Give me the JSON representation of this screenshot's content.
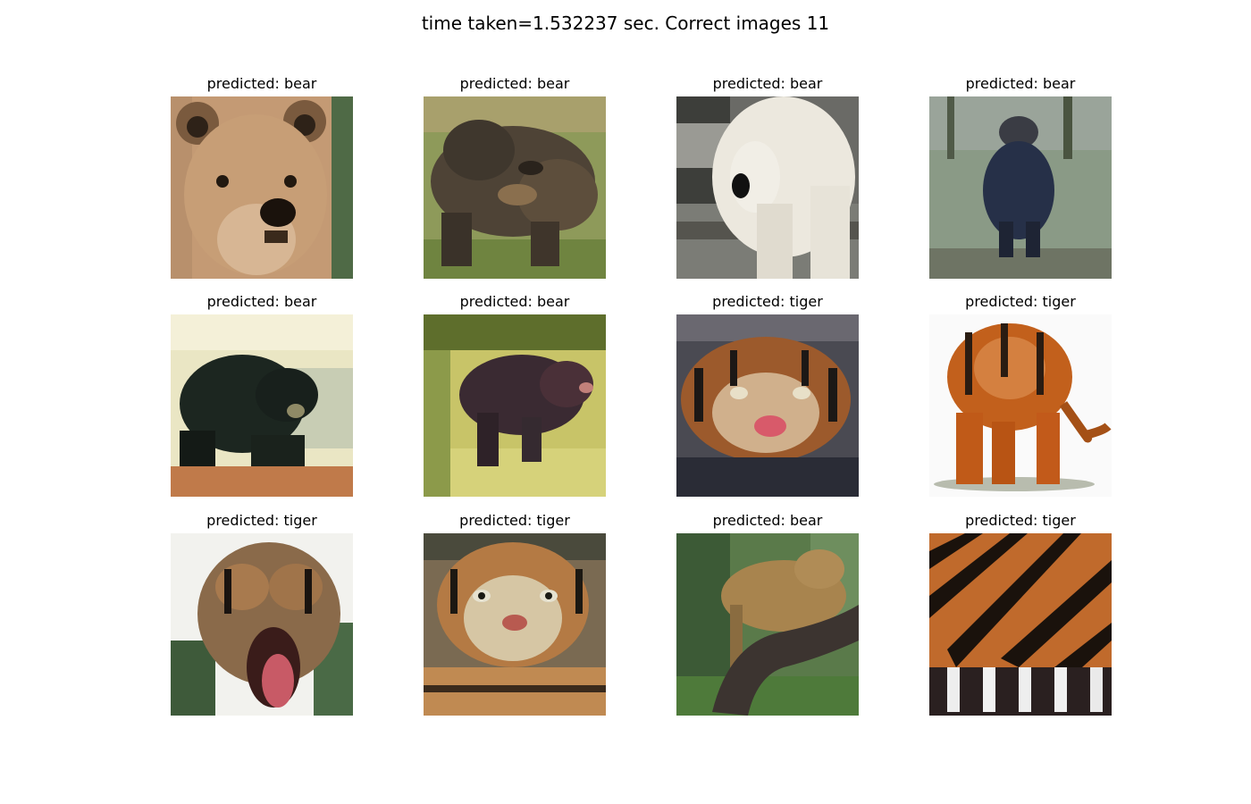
{
  "figure": {
    "title": "time taken=1.532237 sec. Correct images 11"
  },
  "panels": [
    {
      "title": "predicted: bear",
      "depicts": "bear"
    },
    {
      "title": "predicted: bear",
      "depicts": "bear"
    },
    {
      "title": "predicted: bear",
      "depicts": "polar-bear"
    },
    {
      "title": "predicted: bear",
      "depicts": "bear"
    },
    {
      "title": "predicted: bear",
      "depicts": "bear"
    },
    {
      "title": "predicted: bear",
      "depicts": "bear"
    },
    {
      "title": "predicted: tiger",
      "depicts": "tiger"
    },
    {
      "title": "predicted: tiger",
      "depicts": "tiger"
    },
    {
      "title": "predicted: tiger",
      "depicts": "tiger"
    },
    {
      "title": "predicted: tiger",
      "depicts": "tiger"
    },
    {
      "title": "predicted: bear",
      "depicts": "tiger"
    },
    {
      "title": "predicted: tiger",
      "depicts": "tiger"
    }
  ]
}
